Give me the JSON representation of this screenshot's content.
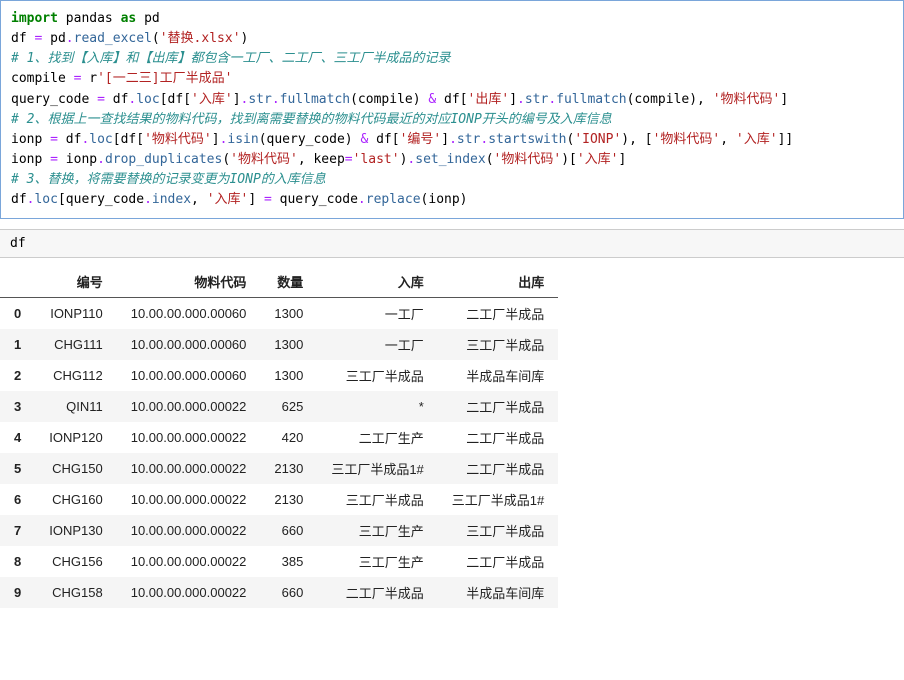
{
  "code": {
    "l1": {
      "a": "import",
      "b": " pandas ",
      "c": "as",
      "d": " pd"
    },
    "blank1": "",
    "l2": {
      "a": "df ",
      "b": "=",
      "c": " pd",
      "d": ".",
      "e": "read_excel",
      "f": "(",
      "g": "'替换.xlsx'",
      "h": ")"
    },
    "blank2": "",
    "c1": "# 1、找到【入库】和【出库】都包含一工厂、二工厂、三工厂半成品的记录",
    "l3": {
      "a": "compile ",
      "b": "=",
      "c": " r",
      "d": "'[一二三]工厂半成品'"
    },
    "l4": {
      "a": "query_code ",
      "b": "=",
      "c": " df",
      "d": ".",
      "e": "loc",
      "f": "[df[",
      "g": "'入库'",
      "h": "]",
      "i": ".",
      "j": "str",
      "k": ".",
      "l": "fullmatch",
      "m": "(compile) ",
      "n": "&",
      "o": " df[",
      "p": "'出库'",
      "q": "]",
      "r": ".",
      "s": "str",
      "t": ".",
      "u": "fullmatch",
      "v": "(compile), ",
      "w": "'物料代码'",
      "x": "]"
    },
    "c2": "# 2、根据上一查找结果的物料代码，找到离需要替换的物料代码最近的对应IONP开头的编号及入库信息",
    "l5": {
      "a": "ionp ",
      "b": "=",
      "c": " df",
      "d": ".",
      "e": "loc",
      "f": "[df[",
      "g": "'物料代码'",
      "h": "]",
      "i": ".",
      "j": "isin",
      "k": "(query_code) ",
      "l": "&",
      "m": " df[",
      "n": "'编号'",
      "o": "]",
      "p": ".",
      "q": "str",
      "r": ".",
      "s": "startswith",
      "t": "(",
      "u": "'IONP'",
      "v": "), [",
      "w": "'物料代码'",
      "x": ", ",
      "y": "'入库'",
      "z": "]]"
    },
    "l6": {
      "a": "ionp ",
      "b": "=",
      "c": " ionp",
      "d": ".",
      "e": "drop_duplicates",
      "f": "(",
      "g": "'物料代码'",
      "h": ", keep",
      "i": "=",
      "j": "'last'",
      "k": ")",
      "l": ".",
      "m": "set_index",
      "n": "(",
      "o": "'物料代码'",
      "p": ")[",
      "q": "'入库'",
      "r": "]"
    },
    "c3": "# 3、替换，将需要替换的记录变更为IONP的入库信息",
    "l7": {
      "a": "df",
      "b": ".",
      "c": "loc",
      "d": "[query_code",
      "e": ".",
      "f": "index",
      "g": ", ",
      "h": "'入库'",
      "i": "] ",
      "j": "=",
      "k": " query_code",
      "l": ".",
      "m": "replace",
      "n": "(ionp)"
    }
  },
  "out_label": "df",
  "table": {
    "headers": [
      "编号",
      "物料代码",
      "数量",
      "入库",
      "出库"
    ],
    "rows": [
      {
        "idx": "0",
        "cells": [
          "IONP110",
          "10.00.00.000.00060",
          "1300",
          "一工厂",
          "二工厂半成品"
        ]
      },
      {
        "idx": "1",
        "cells": [
          "CHG111",
          "10.00.00.000.00060",
          "1300",
          "一工厂",
          "三工厂半成品"
        ]
      },
      {
        "idx": "2",
        "cells": [
          "CHG112",
          "10.00.00.000.00060",
          "1300",
          "三工厂半成品",
          "半成品车间库"
        ]
      },
      {
        "idx": "3",
        "cells": [
          "QIN11",
          "10.00.00.000.00022",
          "625",
          "*",
          "二工厂半成品"
        ]
      },
      {
        "idx": "4",
        "cells": [
          "IONP120",
          "10.00.00.000.00022",
          "420",
          "二工厂生产",
          "二工厂半成品"
        ]
      },
      {
        "idx": "5",
        "cells": [
          "CHG150",
          "10.00.00.000.00022",
          "2130",
          "三工厂半成品1#",
          "二工厂半成品"
        ]
      },
      {
        "idx": "6",
        "cells": [
          "CHG160",
          "10.00.00.000.00022",
          "2130",
          "三工厂半成品",
          "三工厂半成品1#"
        ]
      },
      {
        "idx": "7",
        "cells": [
          "IONP130",
          "10.00.00.000.00022",
          "660",
          "三工厂生产",
          "三工厂半成品"
        ]
      },
      {
        "idx": "8",
        "cells": [
          "CHG156",
          "10.00.00.000.00022",
          "385",
          "三工厂生产",
          "二工厂半成品"
        ]
      },
      {
        "idx": "9",
        "cells": [
          "CHG158",
          "10.00.00.000.00022",
          "660",
          "二工厂半成品",
          "半成品车间库"
        ]
      }
    ]
  }
}
